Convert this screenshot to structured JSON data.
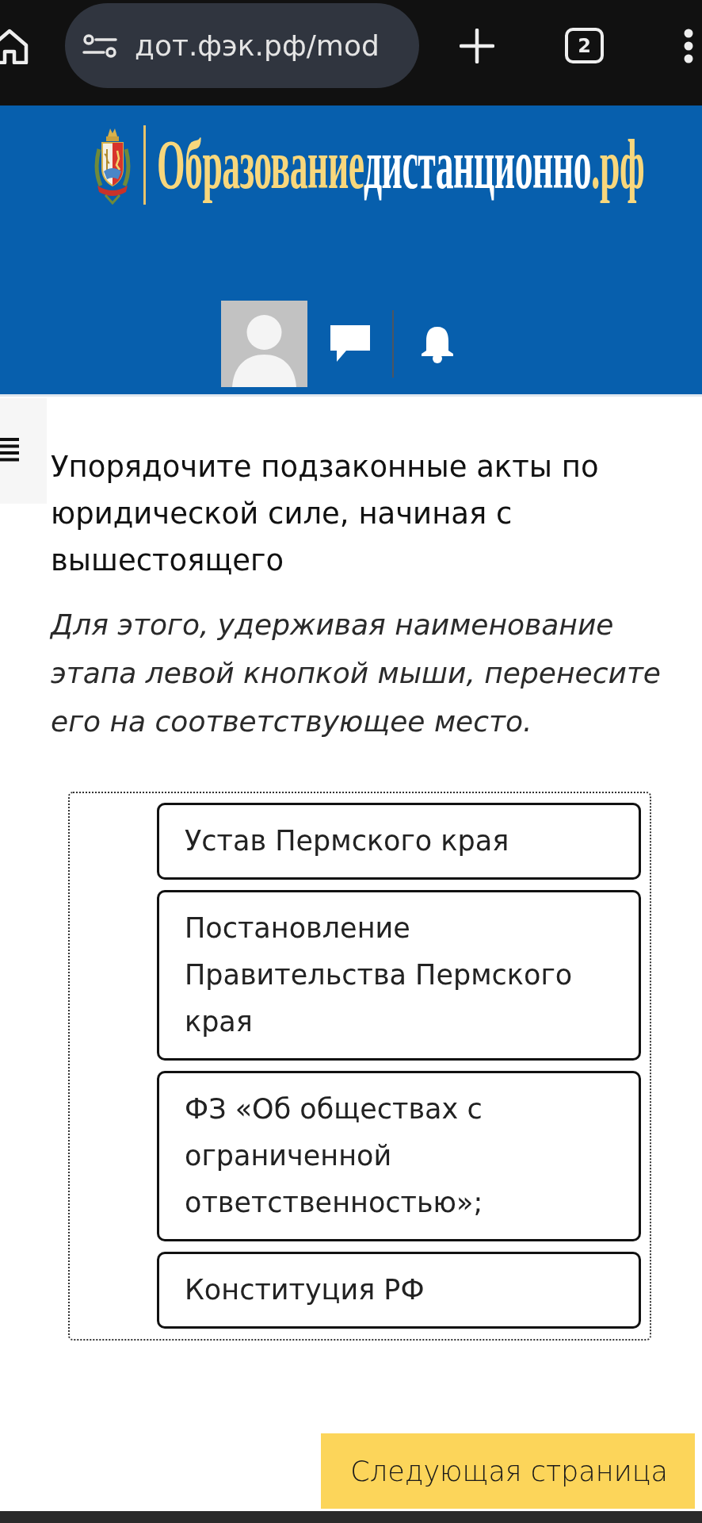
{
  "browser_bar": {
    "url": "дот.фэк.рф/mod",
    "tab_count": "2"
  },
  "header": {
    "logo_parts": [
      {
        "text": "Образование",
        "color": "#f8d77c"
      },
      {
        "text": "дистанционно",
        "color": "#ffffff"
      },
      {
        "text": ".рф",
        "color": "#f8d77c"
      }
    ]
  },
  "question": {
    "title": "Упорядочите подзаконные акты по юридической силе, начиная с вышестоящего",
    "instruction": "Для этого, удерживая наименование этапа левой кнопкой мыши, перенесите его на соответствующее место."
  },
  "ordering_items": [
    {
      "label": "Устав Пермского края"
    },
    {
      "label": "Постановление Правительства Пермского края"
    },
    {
      "label": "ФЗ «Об обществах с ограниченной ответственностью»;"
    },
    {
      "label": "Конституция РФ"
    }
  ],
  "next_button": {
    "label": "Следующая страница"
  }
}
